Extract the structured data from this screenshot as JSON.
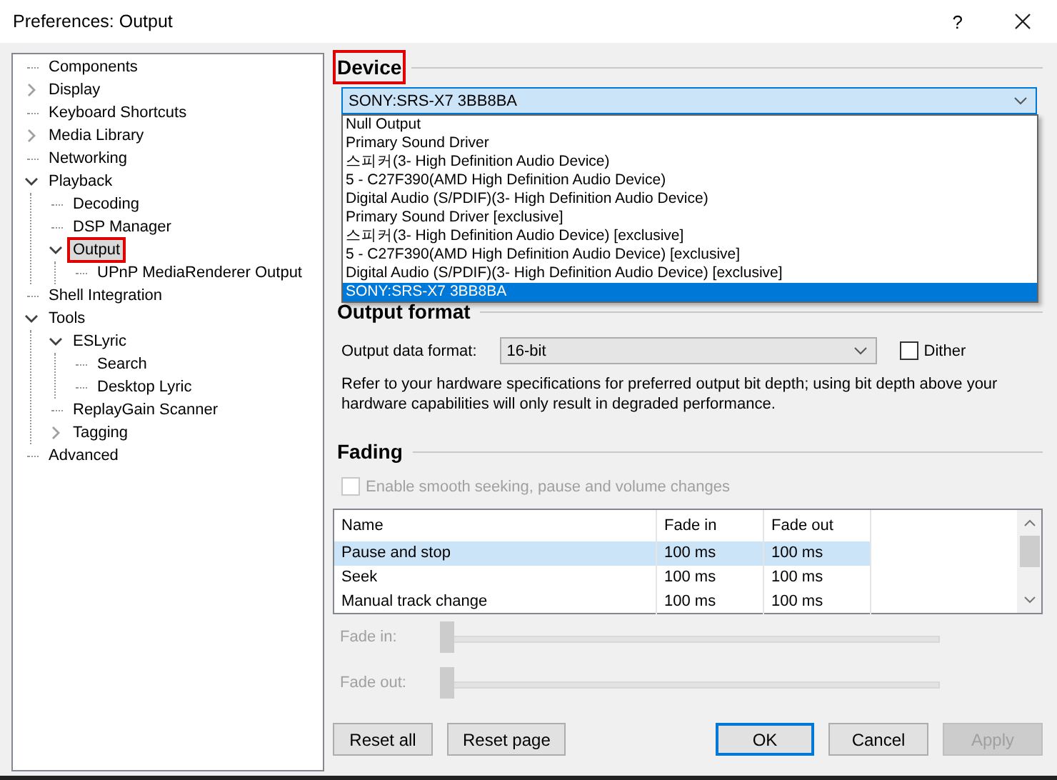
{
  "window": {
    "title": "Preferences: Output",
    "help": "?"
  },
  "tree": [
    {
      "label": "Components",
      "selected": false,
      "annotated": false
    },
    {
      "label": "Display",
      "selected": false,
      "annotated": false,
      "expanded": false
    },
    {
      "label": "Keyboard Shortcuts",
      "selected": false,
      "annotated": false
    },
    {
      "label": "Media Library",
      "selected": false,
      "annotated": false,
      "expanded": false
    },
    {
      "label": "Networking",
      "selected": false,
      "annotated": false
    },
    {
      "label": "Playback",
      "selected": false,
      "annotated": false,
      "expanded": true,
      "children": [
        {
          "label": "Decoding",
          "selected": false,
          "annotated": false
        },
        {
          "label": "DSP Manager",
          "selected": false,
          "annotated": false
        },
        {
          "label": "Output",
          "selected": true,
          "annotated": true,
          "expanded": true,
          "children": [
            {
              "label": "UPnP MediaRenderer Output",
              "selected": false,
              "annotated": false
            }
          ]
        }
      ]
    },
    {
      "label": "Shell Integration",
      "selected": false,
      "annotated": false
    },
    {
      "label": "Tools",
      "selected": false,
      "annotated": false,
      "expanded": true,
      "children": [
        {
          "label": "ESLyric",
          "selected": false,
          "annotated": false,
          "expanded": true,
          "children": [
            {
              "label": "Search",
              "selected": false,
              "annotated": false
            },
            {
              "label": "Desktop Lyric",
              "selected": false,
              "annotated": false
            }
          ]
        },
        {
          "label": "ReplayGain Scanner",
          "selected": false,
          "annotated": false
        },
        {
          "label": "Tagging",
          "selected": false,
          "annotated": false,
          "expanded": false
        }
      ]
    },
    {
      "label": "Advanced",
      "selected": false,
      "annotated": false
    }
  ],
  "device": {
    "heading": "Device",
    "annotated": true,
    "value": "SONY:SRS-X7 3BB8BA",
    "open": true,
    "options": [
      {
        "label": "Null Output",
        "selected": false
      },
      {
        "label": "Primary Sound Driver",
        "selected": false
      },
      {
        "label": "스피커(3- High Definition Audio Device)",
        "selected": false
      },
      {
        "label": "5 - C27F390(AMD High Definition Audio Device)",
        "selected": false
      },
      {
        "label": "Digital Audio (S/PDIF)(3- High Definition Audio Device)",
        "selected": false
      },
      {
        "label": "Primary Sound Driver [exclusive]",
        "selected": false
      },
      {
        "label": "스피커(3- High Definition Audio Device) [exclusive]",
        "selected": false
      },
      {
        "label": "5 - C27F390(AMD High Definition Audio Device) [exclusive]",
        "selected": false
      },
      {
        "label": "Digital Audio (S/PDIF)(3- High Definition Audio Device) [exclusive]",
        "selected": false
      },
      {
        "label": "SONY:SRS-X7 3BB8BA",
        "selected": true
      }
    ]
  },
  "output_format": {
    "heading": "Output format",
    "label": "Output data format:",
    "value": "16-bit",
    "dither": {
      "label": "Dither",
      "checked": false
    },
    "note": "Refer to your hardware specifications for preferred output bit depth; using bit depth above your hardware capabilities will only result in degraded performance."
  },
  "fading": {
    "heading": "Fading",
    "smooth": {
      "label": "Enable smooth seeking, pause and volume changes",
      "checked": false,
      "disabled": true
    },
    "columns": [
      "Name",
      "Fade in",
      "Fade out"
    ],
    "rows": [
      {
        "cells": [
          "Pause and stop",
          "100 ms",
          "100 ms"
        ],
        "selected": true
      },
      {
        "cells": [
          "Seek",
          "100 ms",
          "100 ms"
        ],
        "selected": false
      },
      {
        "cells": [
          "Manual track change",
          "100 ms",
          "100 ms"
        ],
        "selected": false
      }
    ],
    "sliders": [
      {
        "label": "Fade in:",
        "level": 0,
        "disabled": true
      },
      {
        "label": "Fade out:",
        "level": 0,
        "disabled": true
      }
    ]
  },
  "buttons": [
    {
      "label": "Reset all",
      "kind": "normal",
      "disabled": false
    },
    {
      "label": "Reset page",
      "kind": "normal",
      "disabled": false
    },
    {
      "label": "OK",
      "kind": "default",
      "disabled": false
    },
    {
      "label": "Cancel",
      "kind": "normal",
      "disabled": false
    },
    {
      "label": "Apply",
      "kind": "normal",
      "disabled": true
    }
  ]
}
